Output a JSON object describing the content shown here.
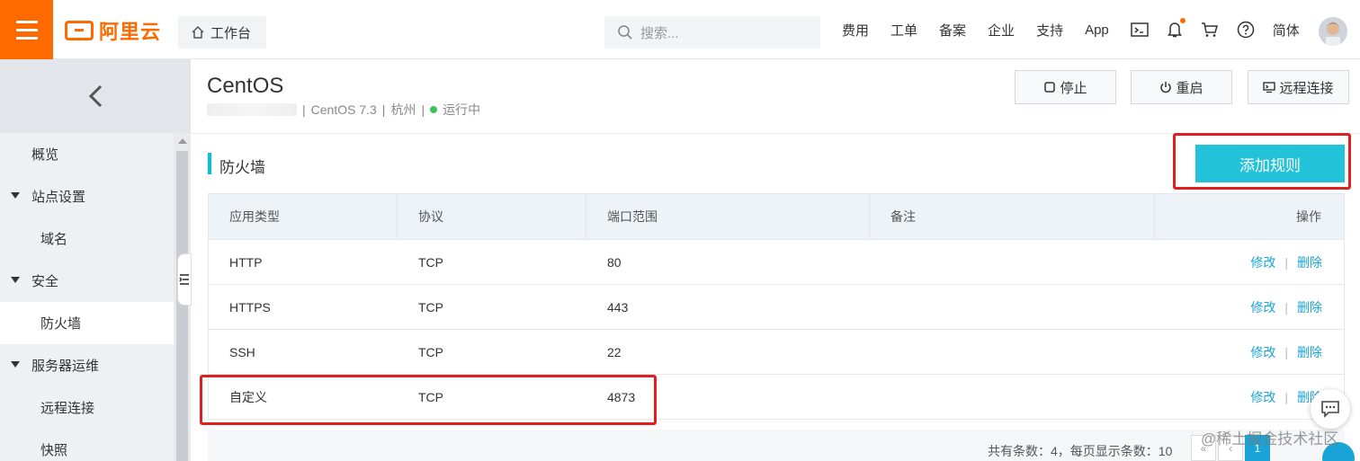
{
  "header": {
    "logo_text": "阿里云",
    "workbench_label": "工作台",
    "search_placeholder": "搜索...",
    "nav": [
      "费用",
      "工单",
      "备案",
      "企业",
      "支持",
      "App"
    ],
    "lang_label": "简体",
    "brand_color": "#ff6a00"
  },
  "sidebar": {
    "items": [
      {
        "label": "概览"
      },
      {
        "label": "站点设置"
      },
      {
        "label": "域名"
      },
      {
        "label": "安全"
      },
      {
        "label": "防火墙"
      },
      {
        "label": "服务器运维"
      },
      {
        "label": "远程连接"
      },
      {
        "label": "快照"
      }
    ]
  },
  "instance": {
    "title": "CentOS",
    "os_version": "CentOS 7.3",
    "region": "杭州",
    "status": "运行中",
    "separator": "|"
  },
  "actions": {
    "stop": "停止",
    "restart": "重启",
    "remote": "远程连接"
  },
  "firewall": {
    "title": "防火墙",
    "add_rule": "添加规则",
    "accent": "#00c1de",
    "columns": [
      "应用类型",
      "协议",
      "端口范围",
      "备注",
      "操作"
    ],
    "rows": [
      {
        "type": "HTTP",
        "protocol": "TCP",
        "port": "80",
        "note": "",
        "edit": "修改",
        "delete": "删除"
      },
      {
        "type": "HTTPS",
        "protocol": "TCP",
        "port": "443",
        "note": "",
        "edit": "修改",
        "delete": "删除"
      },
      {
        "type": "SSH",
        "protocol": "TCP",
        "port": "22",
        "note": "",
        "edit": "修改",
        "delete": "删除"
      },
      {
        "type": "自定义",
        "protocol": "TCP",
        "port": "4873",
        "note": "",
        "edit": "修改",
        "delete": "删除"
      }
    ],
    "op_separator": "|"
  },
  "pagination": {
    "summary": "共有条数：4，每页显示条数：10",
    "first": "«",
    "prev": "‹",
    "current": "1"
  },
  "watermark": "@稀土掘金技术社区"
}
